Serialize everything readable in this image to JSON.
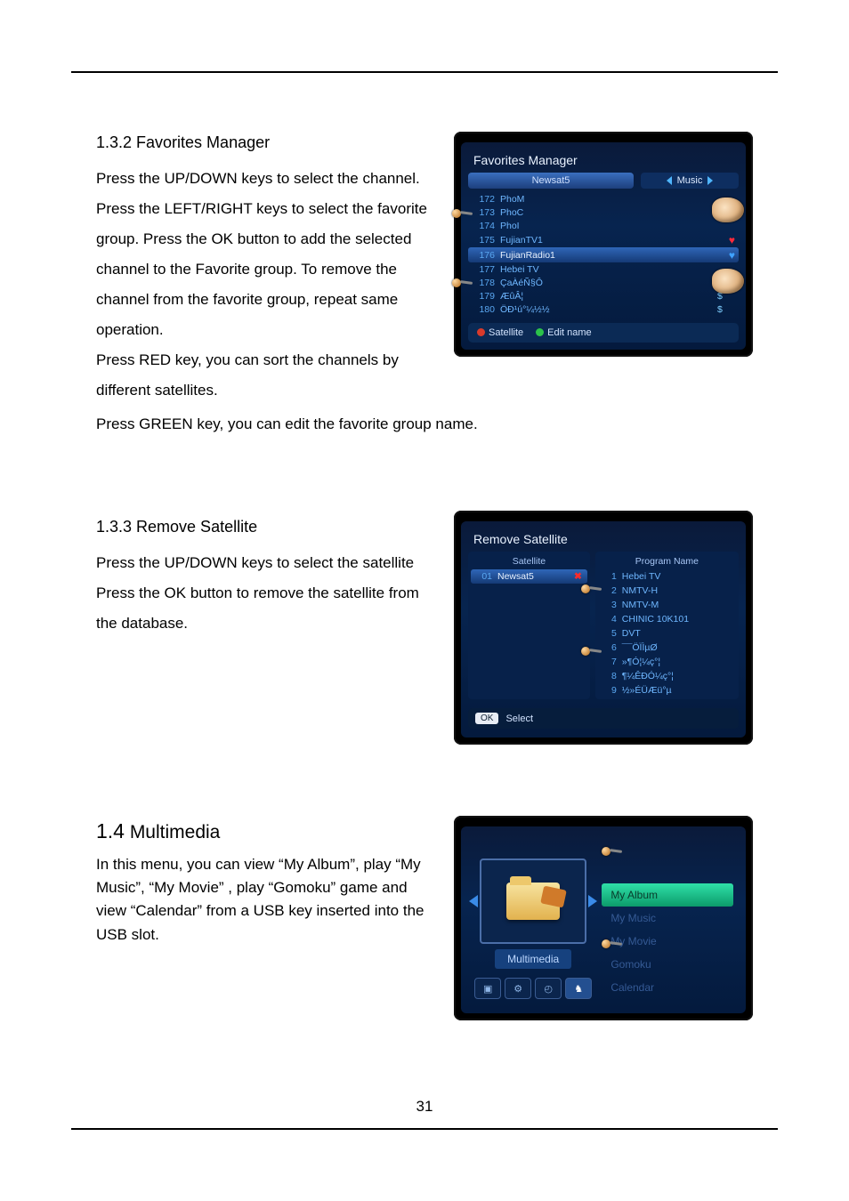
{
  "page_number": "31",
  "sections": {
    "favorites": {
      "heading": "1.3.2 Favorites Manager",
      "p1": "Press the UP/DOWN keys to select the channel.",
      "p2": "Press the LEFT/RIGHT keys to select the favorite group. Press the OK button to add the selected channel to the Favorite group. To remove the channel from the favorite group, repeat same operation.",
      "p3": "Press RED key, you can sort the channels by different satellites.",
      "after": "Press GREEN key, you can edit the favorite group name."
    },
    "remove": {
      "heading": "1.3.3 Remove Satellite",
      "p1": "Press the UP/DOWN keys to select the satellite",
      "p2": "Press the OK button to remove the satellite from the database."
    },
    "multimedia": {
      "heading_prefix": "1.4",
      "heading_rest": " Multimedia",
      "p1": "In this menu, you can view “My Album”, play “My Music”, “My Movie” , play “Gomoku” game and view “Calendar” from a USB key inserted into the USB slot."
    }
  },
  "screenshots": {
    "favorites": {
      "title": "Favorites Manager",
      "satellite": "Newsat5",
      "group": "Music",
      "hint_satellite": "Satellite",
      "hint_edit": "Edit name",
      "channels": [
        {
          "num": "172",
          "name": "PhoM",
          "mark": "",
          "fav": ""
        },
        {
          "num": "173",
          "name": "PhoC",
          "mark": "",
          "fav": ""
        },
        {
          "num": "174",
          "name": "PhoI",
          "mark": "",
          "fav": ""
        },
        {
          "num": "175",
          "name": "FujianTV1",
          "mark": "",
          "fav": "red"
        },
        {
          "num": "176",
          "name": "FujianRadio1",
          "mark": "",
          "fav": "blue",
          "selected": true
        },
        {
          "num": "177",
          "name": "Hebei TV",
          "mark": "",
          "fav": ""
        },
        {
          "num": "178",
          "name": "ÇaÀéÑ§Ô",
          "mark": "$",
          "fav": ""
        },
        {
          "num": "179",
          "name": "ÆûÂ¦",
          "mark": "$",
          "fav": ""
        },
        {
          "num": "180",
          "name": "ÖÐ¹ú°¼½½",
          "mark": "$",
          "fav": ""
        }
      ]
    },
    "remove": {
      "title": "Remove Satellite",
      "left_header": "Satellite",
      "right_header": "Program Name",
      "ok_label": "OK",
      "ok_text": "Select",
      "satellites": [
        {
          "num": "01",
          "name": "Newsat5",
          "selected": true,
          "remove": true
        }
      ],
      "programs": [
        {
          "num": "1",
          "name": "Hebei TV"
        },
        {
          "num": "2",
          "name": "NMTV-H"
        },
        {
          "num": "3",
          "name": "NMTV-M"
        },
        {
          "num": "4",
          "name": "CHINIC 10K101"
        },
        {
          "num": "5",
          "name": "DVT"
        },
        {
          "num": "6",
          "name": "¯¯ÖÏÌµØ"
        },
        {
          "num": "7",
          "name": "»¶Ó¦¼ç°¦"
        },
        {
          "num": "8",
          "name": "¶¼ÊÐÓ¼ç°¦"
        },
        {
          "num": "9",
          "name": "½»ÉÜÆü°µ"
        }
      ]
    },
    "multimedia": {
      "panel_label": "Multimedia",
      "menu": [
        {
          "label": "My Album",
          "selected": true
        },
        {
          "label": "My Music"
        },
        {
          "label": "My Movie"
        },
        {
          "label": "Gomoku"
        },
        {
          "label": "Calendar"
        }
      ],
      "tabs": [
        "▣",
        "⚙",
        "◴",
        "♞"
      ]
    }
  }
}
